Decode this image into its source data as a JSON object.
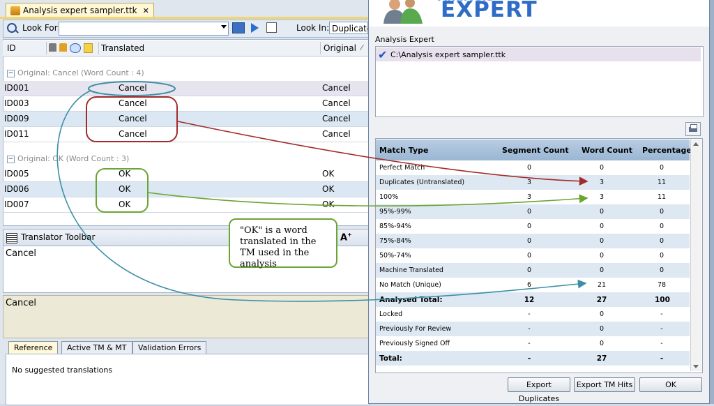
{
  "editor": {
    "doc_tab": "Analysis expert sampler.ttk",
    "look_for_label": "Look For:",
    "look_for_value": "",
    "look_in_label": "Look In:",
    "look_in_value": "Duplicate",
    "columns": {
      "id": "ID",
      "translated": "Translated",
      "original": "Original"
    },
    "groups": [
      {
        "label": "Original: Cancel (Word Count : 4)",
        "rows": [
          {
            "id": "ID001",
            "translated": "Cancel",
            "original": "Cancel"
          },
          {
            "id": "ID003",
            "translated": "Cancel",
            "original": "Cancel"
          },
          {
            "id": "ID009",
            "translated": "Cancel",
            "original": "Cancel"
          },
          {
            "id": "ID011",
            "translated": "Cancel",
            "original": "Cancel"
          }
        ]
      },
      {
        "label": "Original: OK (Word Count : 3)",
        "rows": [
          {
            "id": "ID005",
            "translated": "OK",
            "original": "OK"
          },
          {
            "id": "ID006",
            "translated": "OK",
            "original": "OK"
          },
          {
            "id": "ID007",
            "translated": "OK",
            "original": "OK"
          }
        ]
      }
    ],
    "translator_toolbar_title": "Translator Toolbar",
    "source_text": "Cancel",
    "target_text": "Cancel",
    "bottom_tabs": [
      "Reference",
      "Active TM & MT",
      "Validation Errors"
    ],
    "suggestions_text": "No suggested translations"
  },
  "dialog": {
    "banner_text": "EXPERT",
    "section_label": "Analysis Expert",
    "file": "C:\\Analysis expert sampler.ttk",
    "table_headers": {
      "match_type": "Match Type",
      "segment_count": "Segment Count",
      "word_count": "Word Count",
      "percentage": "Percentage"
    },
    "rows": [
      {
        "type": "Perfect Match",
        "seg": "0",
        "words": "0",
        "pct": "0"
      },
      {
        "type": "Duplicates (Untranslated)",
        "seg": "3",
        "words": "3",
        "pct": "11"
      },
      {
        "type": "100%",
        "seg": "3",
        "words": "3",
        "pct": "11"
      },
      {
        "type": "95%-99%",
        "seg": "0",
        "words": "0",
        "pct": "0"
      },
      {
        "type": "85%-94%",
        "seg": "0",
        "words": "0",
        "pct": "0"
      },
      {
        "type": "75%-84%",
        "seg": "0",
        "words": "0",
        "pct": "0"
      },
      {
        "type": "50%-74%",
        "seg": "0",
        "words": "0",
        "pct": "0"
      },
      {
        "type": "Machine Translated",
        "seg": "0",
        "words": "0",
        "pct": "0"
      },
      {
        "type": "No Match (Unique)",
        "seg": "6",
        "words": "21",
        "pct": "78"
      },
      {
        "type": "Analysed Total:",
        "seg": "12",
        "words": "27",
        "pct": "100"
      },
      {
        "type": "Locked",
        "seg": "-",
        "words": "0",
        "pct": "-"
      },
      {
        "type": "Previously For Review",
        "seg": "-",
        "words": "0",
        "pct": "-"
      },
      {
        "type": "Previously Signed Off",
        "seg": "-",
        "words": "0",
        "pct": "-"
      },
      {
        "type": "Total:",
        "seg": "-",
        "words": "27",
        "pct": "-"
      }
    ],
    "buttons": {
      "export_duplicates": "Export Duplicates",
      "export_tm_hits": "Export TM Hits",
      "ok": "OK"
    }
  },
  "callout": {
    "text": "\"OK\" is a word translated in the TM used in the analysis"
  },
  "colors": {
    "blue_annotation": "#3d8ea5",
    "red_annotation": "#a32a2a",
    "green_annotation": "#6aa433",
    "dialog_brand": "#2e6cc7"
  }
}
